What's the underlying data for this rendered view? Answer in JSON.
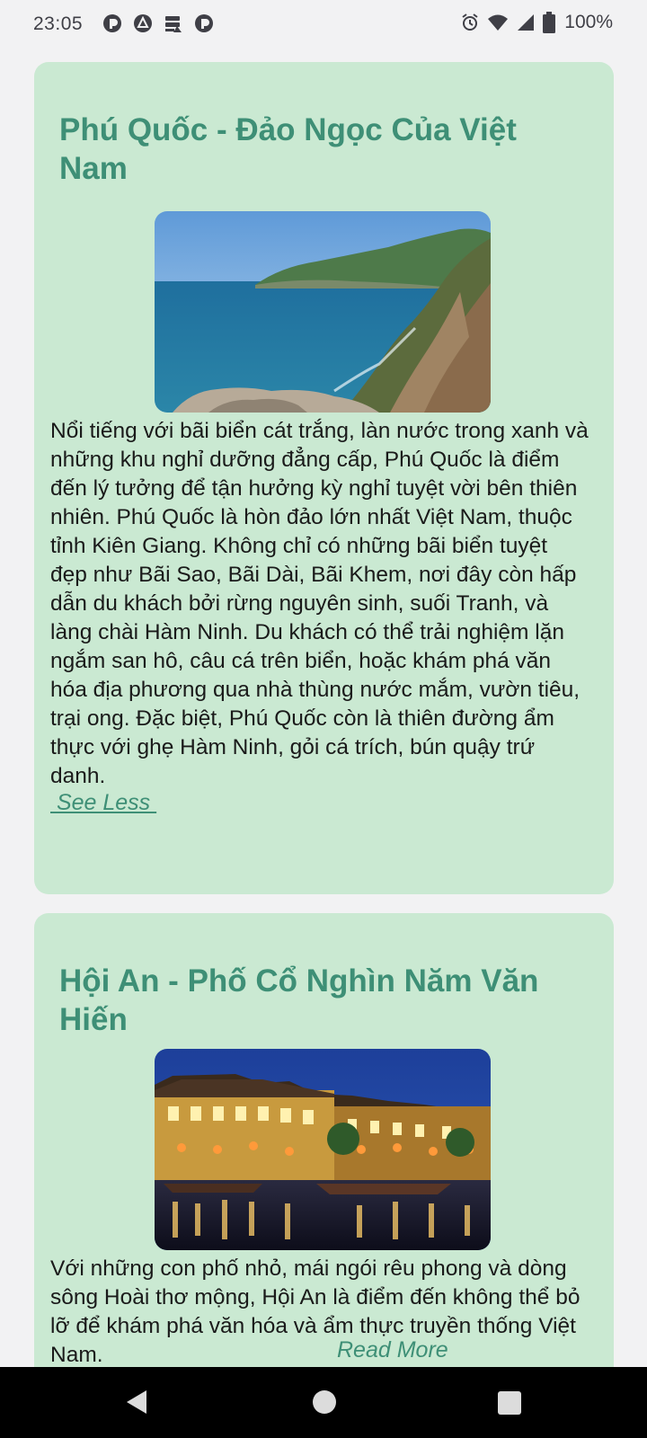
{
  "status_bar": {
    "time": "23:05",
    "battery": "100%",
    "icons_left": [
      "pocket-icon",
      "drive-icon",
      "storage-icon",
      "pocket-icon"
    ],
    "icons_right": [
      "alarm-icon",
      "wifi-icon",
      "signal-icon",
      "battery-icon"
    ]
  },
  "cards": [
    {
      "title": "Phú Quốc - Đảo Ngọc Của Việt Nam",
      "image": "coastline-cliffs-image",
      "description": "Nổi tiếng với bãi biển cát trắng, làn nước trong xanh và những khu nghỉ dưỡng đẳng cấp, Phú Quốc là điểm đến lý tưởng để tận hưởng kỳ nghỉ tuyệt vời bên thiên nhiên. Phú Quốc là hòn đảo lớn nhất Việt Nam, thuộc tỉnh Kiên Giang. Không chỉ có những bãi biển tuyệt đẹp như Bãi Sao, Bãi Dài, Bãi Khem, nơi đây còn hấp dẫn du khách bởi rừng nguyên sinh, suối Tranh, và làng chài Hàm Ninh. Du khách có thể trải nghiệm lặn ngắm san hô, câu cá trên biển, hoặc khám phá văn hóa địa phương qua nhà thùng nước mắm, vườn tiêu, trại ong. Đặc biệt, Phú Quốc còn là thiên đường ẩm thực với ghẹ Hàm Ninh, gỏi cá trích, bún quậy trứ danh.",
      "toggle_label": " See Less "
    },
    {
      "title": "Hội An - Phố Cổ Nghìn Năm Văn Hiến",
      "image": "old-town-night-image",
      "description": "Với những con phố nhỏ, mái ngói rêu phong và dòng sông Hoài thơ mộng, Hội An là điểm đến không thể bỏ lỡ để khám phá văn hóa và ẩm thực truyền thống Việt Nam.",
      "toggle_label": "Read More"
    }
  ],
  "nav_bar": {
    "buttons": [
      "back-button",
      "home-button",
      "recents-button"
    ]
  },
  "colors": {
    "card_bg": "#cae9d2",
    "title": "#3e8f76",
    "page_bg": "#f2f2f3"
  }
}
